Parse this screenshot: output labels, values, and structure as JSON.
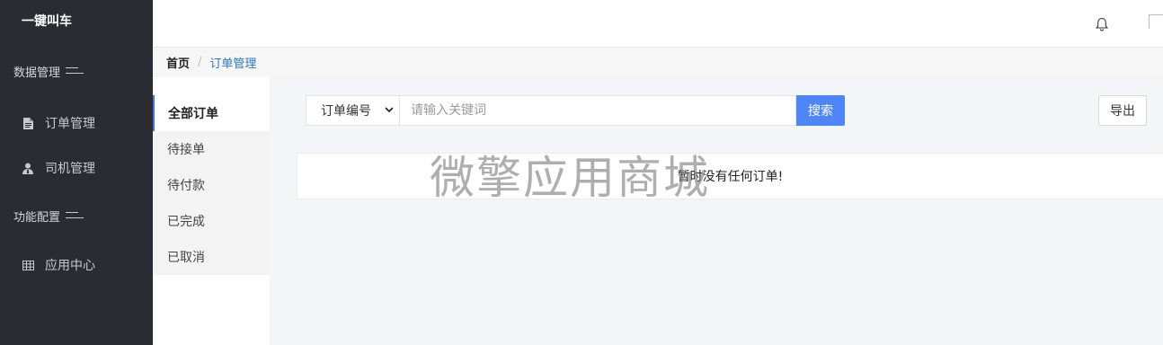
{
  "sidebar": {
    "brand": "一键叫车",
    "groups": [
      {
        "label": "数据管理",
        "items": [
          {
            "label": "订单管理",
            "icon": "file-icon"
          },
          {
            "label": "司机管理",
            "icon": "user-tie-icon"
          }
        ]
      },
      {
        "label": "功能配置",
        "items": [
          {
            "label": "应用中心",
            "icon": "table-icon"
          }
        ]
      }
    ]
  },
  "topbar": {
    "bell_icon": "bell-icon",
    "avatar_icon": "broken-image-icon"
  },
  "breadcrumb": {
    "home": "首页",
    "separator": "/",
    "current": "订单管理"
  },
  "subnav": {
    "items": [
      "全部订单",
      "待接单",
      "待付款",
      "已完成",
      "已取消"
    ],
    "active": "全部订单"
  },
  "search": {
    "select_value": "订单编号",
    "placeholder": "请输入关键词",
    "button": "搜索"
  },
  "export_button": "导出",
  "empty_message": "暂时没有任何订单!",
  "watermark": "微擎应用商城",
  "colors": {
    "sidebar_bg": "#2a2c31",
    "accent": "#4f86f7",
    "breadcrumb_link": "#2b78c5"
  }
}
